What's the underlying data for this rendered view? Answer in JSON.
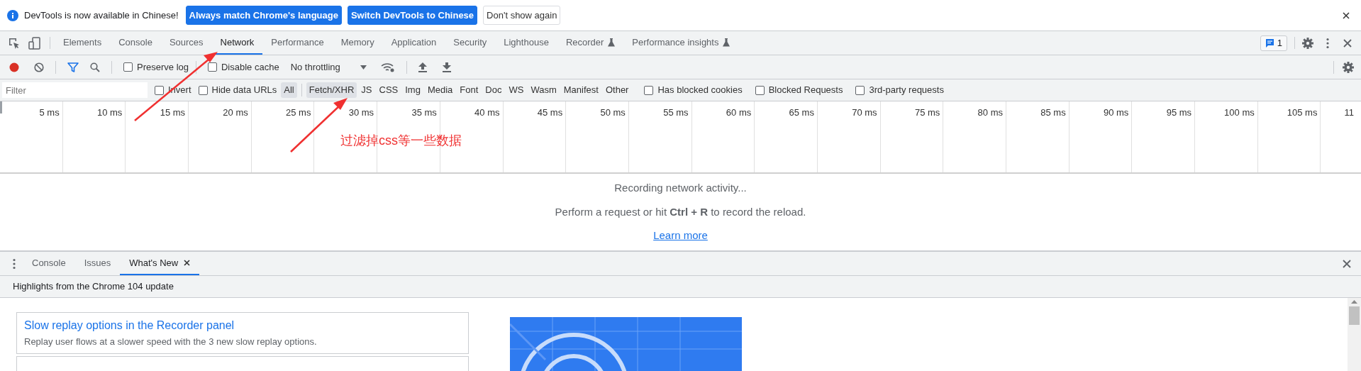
{
  "infobar": {
    "message": "DevTools is now available in Chinese!",
    "buttons": [
      {
        "label": "Always match Chrome's language",
        "kind": "primary"
      },
      {
        "label": "Switch DevTools to Chinese",
        "kind": "primary"
      },
      {
        "label": "Don't show again",
        "kind": "secondary"
      }
    ]
  },
  "tabs": [
    {
      "label": "Elements",
      "selected": false,
      "experimental": false
    },
    {
      "label": "Console",
      "selected": false,
      "experimental": false
    },
    {
      "label": "Sources",
      "selected": false,
      "experimental": false
    },
    {
      "label": "Network",
      "selected": true,
      "experimental": false
    },
    {
      "label": "Performance",
      "selected": false,
      "experimental": false
    },
    {
      "label": "Memory",
      "selected": false,
      "experimental": false
    },
    {
      "label": "Application",
      "selected": false,
      "experimental": false
    },
    {
      "label": "Security",
      "selected": false,
      "experimental": false
    },
    {
      "label": "Lighthouse",
      "selected": false,
      "experimental": false
    },
    {
      "label": "Recorder",
      "selected": false,
      "experimental": true
    },
    {
      "label": "Performance insights",
      "selected": false,
      "experimental": true
    }
  ],
  "issues_badge": "1",
  "toolbar": {
    "recording": true,
    "options": [
      {
        "label": "Preserve log",
        "checked": false
      },
      {
        "label": "Disable cache",
        "checked": false
      }
    ],
    "throttling": "No throttling"
  },
  "filter": {
    "placeholder": "Filter",
    "options": [
      {
        "label": "Invert",
        "checked": false
      },
      {
        "label": "Hide data URLs",
        "checked": false
      }
    ],
    "types": [
      {
        "label": "All",
        "selected": true
      },
      {
        "label": "Fetch/XHR",
        "selected": true
      },
      {
        "label": "JS",
        "selected": false
      },
      {
        "label": "CSS",
        "selected": false
      },
      {
        "label": "Img",
        "selected": false
      },
      {
        "label": "Media",
        "selected": false
      },
      {
        "label": "Font",
        "selected": false
      },
      {
        "label": "Doc",
        "selected": false
      },
      {
        "label": "WS",
        "selected": false
      },
      {
        "label": "Wasm",
        "selected": false
      },
      {
        "label": "Manifest",
        "selected": false
      },
      {
        "label": "Other",
        "selected": false
      }
    ],
    "extra": [
      {
        "label": "Has blocked cookies",
        "checked": false
      },
      {
        "label": "Blocked Requests",
        "checked": false
      },
      {
        "label": "3rd-party requests",
        "checked": false
      }
    ]
  },
  "timeline_ticks": [
    "5 ms",
    "10 ms",
    "15 ms",
    "20 ms",
    "25 ms",
    "30 ms",
    "35 ms",
    "40 ms",
    "45 ms",
    "50 ms",
    "55 ms",
    "60 ms",
    "65 ms",
    "70 ms",
    "75 ms",
    "80 ms",
    "85 ms",
    "90 ms",
    "95 ms",
    "100 ms",
    "105 ms",
    "11"
  ],
  "empty_state": {
    "title": "Recording network activity...",
    "hint": "Perform a request or hit **Ctrl + R** to record the reload.",
    "link": "Learn more"
  },
  "drawer": {
    "tabs": [
      {
        "label": "Console",
        "selected": false,
        "closable": false
      },
      {
        "label": "Issues",
        "selected": false,
        "closable": false
      },
      {
        "label": "What's New",
        "selected": true,
        "closable": true
      }
    ],
    "heading": "Highlights from the Chrome 104 update",
    "cards": [
      {
        "kind": "full",
        "title": "Slow replay options in the Recorder panel",
        "description": "Replay user flows at a slower speed with the 3 new slow replay options."
      },
      {
        "kind": "cut_off"
      }
    ]
  },
  "annotation": {
    "text": "过滤掉css等一些数据"
  }
}
